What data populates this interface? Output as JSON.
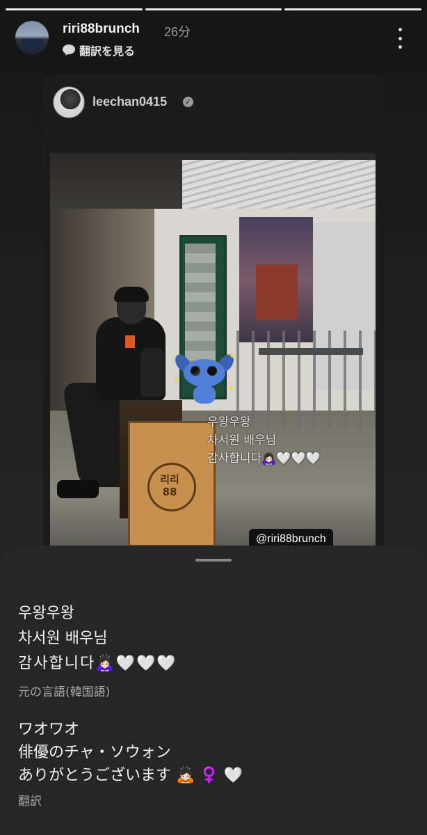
{
  "story": {
    "progress_segments": 3,
    "active_segment": 3
  },
  "header": {
    "username": "riri88brunch",
    "time": "26分",
    "translate_label": "翻訳を見る"
  },
  "shared_post": {
    "username": "leechan0415",
    "overlay_text": [
      "우왕우왕",
      "차서원 배우님",
      "감사합니다🙇🏻‍♀️🤍🤍🤍"
    ],
    "sign_text": "리리\n88",
    "mention": "@riri88brunch"
  },
  "translation_sheet": {
    "original_lines": [
      "우왕우왕",
      "차서원 배우님",
      "감사합니다🙇🏻‍♀️🤍🤍🤍"
    ],
    "original_label": "元の言語(韓国語)",
    "translated_lines": [
      "ワオワオ",
      "俳優のチャ・ソウォン",
      "ありがとうございます 🙇🏻 ♀️ 🤍"
    ],
    "translated_label": "翻訳"
  },
  "colors": {
    "background": "#1b1b1b",
    "sheet": "#262626",
    "secondary_text": "#a8a8a8"
  }
}
